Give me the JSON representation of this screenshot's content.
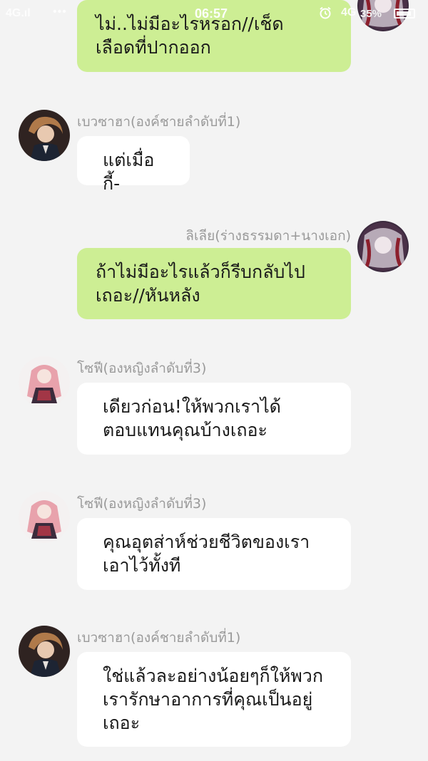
{
  "status_bar": {
    "signal": "4G.ıl",
    "dots": "•••",
    "time": "06:57",
    "network": "4G",
    "battery_percent": "35%"
  },
  "colors": {
    "background": "#f3f3f3",
    "outgoing_bubble": "#cdee94",
    "incoming_bubble": "#ffffff",
    "name_text": "#9a9a9a"
  },
  "messages": [
    {
      "side": "outgoing",
      "avatar": "lilia-avatar",
      "text": "ไม่..ไม่มีอะไรหรอก//เช็ด\nเลือดที่ปากออก"
    },
    {
      "side": "incoming",
      "avatar": "bevzaha-avatar",
      "name": "เบวซาฮา(องค์ชายลำดับที่1)",
      "text": "แต่เมื่อกี้-"
    },
    {
      "side": "outgoing",
      "avatar": "lilia-avatar",
      "name": "ลิเลีย(ร่างธรรมดา+นางเอก)",
      "text": "ถ้าไม่มีอะไรแล้วก็รีบกลับไป\nเถอะ//หันหลัง"
    },
    {
      "side": "incoming",
      "avatar": "sophie-avatar",
      "name": "โซฟี(องหญิงลำดับที่3)",
      "text": "เดียวก่อน!ให้พวกเราได้\nตอบแทนคุณบ้างเถอะ"
    },
    {
      "side": "incoming",
      "avatar": "sophie-avatar",
      "name": "โซฟี(องหญิงลำดับที่3)",
      "text": "คุณอุตส่าห์ช่วยชีวิตของเรา\nเอาไว้ทั้งที"
    },
    {
      "side": "incoming",
      "avatar": "bevzaha-avatar",
      "name": "เบวซาฮา(องค์ชายลำดับที่1)",
      "text": "ใช่แล้วละอย่างน้อยๆก็ให้พวก\nเรารักษาอาการที่คุณเป็นอยู่\nเถอะ"
    }
  ]
}
